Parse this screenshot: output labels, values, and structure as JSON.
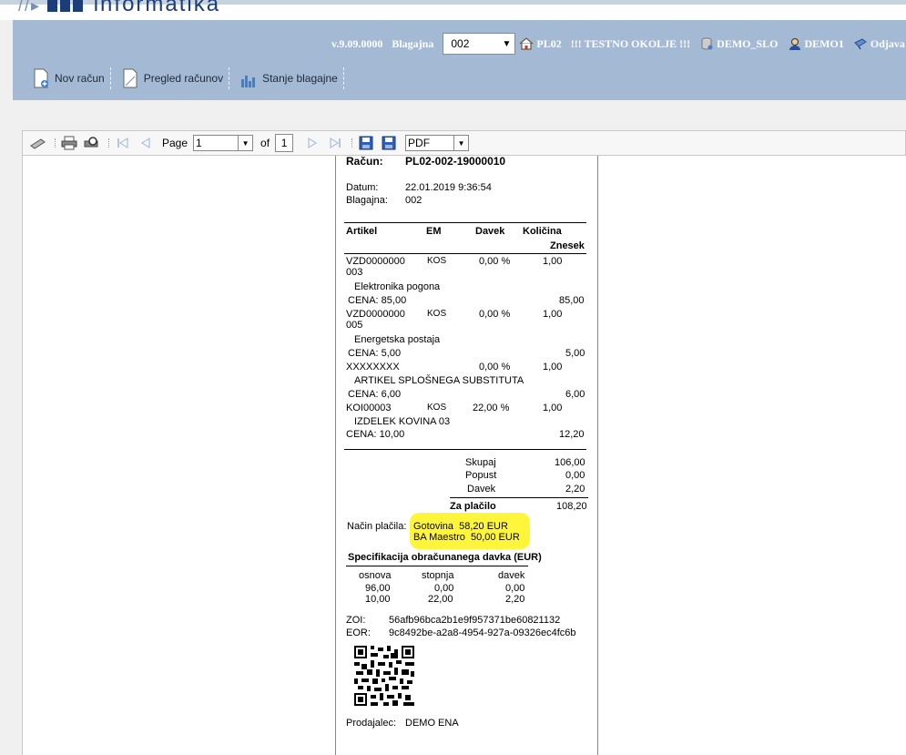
{
  "app": {
    "logo_text": "informatika"
  },
  "header": {
    "version": "v.9.09.0000",
    "register_label": "Blagajna",
    "register_value": "002",
    "location": "PL02",
    "environment": "!!! TESTNO OKOLJE !!!",
    "company": "DEMO_SLO",
    "user": "DEMO1",
    "logout": "Odjava"
  },
  "actions": [
    {
      "label": "Nov račun"
    },
    {
      "label": "Pregled računov"
    },
    {
      "label": "Stanje blagajne"
    }
  ],
  "report_toolbar": {
    "page_label": "Page",
    "page_value": "1",
    "of_label": "of",
    "page_total": "1",
    "format_value": "PDF"
  },
  "receipt": {
    "invoice_label": "Račun:",
    "invoice_number": "PL02-002-19000010",
    "date_label": "Datum:",
    "date_value": "22.01.2019 9:36:54",
    "register_label": "Blagajna:",
    "register_value": "002",
    "columns": {
      "article": "Artikel",
      "unit": "EM",
      "tax": "Davek",
      "quantity": "Količina",
      "amount": "Znesek"
    },
    "items": [
      {
        "code1": "VZD0000000",
        "code2": "003",
        "unit": "KOS",
        "tax": "0,00 %",
        "qty": "1,00",
        "name": "Elektronika pogona",
        "price": "CENA: 85,00",
        "amount": "85,00"
      },
      {
        "code1": "VZD0000000",
        "code2": "005",
        "unit": "KOS",
        "tax": "0,00 %",
        "qty": "1,00",
        "name": "Energetska postaja",
        "price": "CENA: 5,00",
        "amount": "5,00"
      },
      {
        "code1": "XXXXXXXX",
        "code2": "",
        "unit": "",
        "tax": "0,00 %",
        "qty": "1,00",
        "name": "ARTIKEL SPLOŠNEGA SUBSTITUTA",
        "price": "CENA: 6,00",
        "amount": "6,00"
      },
      {
        "code1": "KOI00003",
        "code2": "",
        "unit": "KOS",
        "tax": "22,00 %",
        "qty": "1,00",
        "name": "IZDELEK KOVINA 03",
        "price": "CENA: 10,00",
        "amount": "12,20"
      }
    ],
    "totals": {
      "sum_label": "Skupaj",
      "sum_value": "106,00",
      "discount_label": "Popust",
      "discount_value": "0,00",
      "tax_label": "Davek",
      "tax_value": "2,20",
      "pay_label": "Za plačilo",
      "pay_value": "108,20"
    },
    "payment_label": "Način plačila:",
    "payments": [
      "Gotovina  58,20 EUR",
      "BA Maestro  50,00 EUR"
    ],
    "tax_spec_title": "Specifikacija obračunanega davka (EUR)",
    "tax_spec_columns": {
      "base": "osnova",
      "rate": "stopnja",
      "tax": "davek"
    },
    "tax_spec_rows": [
      {
        "base": "96,00",
        "rate": "0,00",
        "tax": "0,00"
      },
      {
        "base": "10,00",
        "rate": "22,00",
        "tax": "2,20"
      }
    ],
    "zoi_label": "ZOI:",
    "zoi_value": "56afb96bca2b1e9f957371be60821132",
    "eor_label": "EOR:",
    "eor_value": "9c8492be-a2a8-4954-927a-09326ec4fc6b",
    "seller_label": "Prodajalec:",
    "seller_value": "DEMO ENA"
  }
}
